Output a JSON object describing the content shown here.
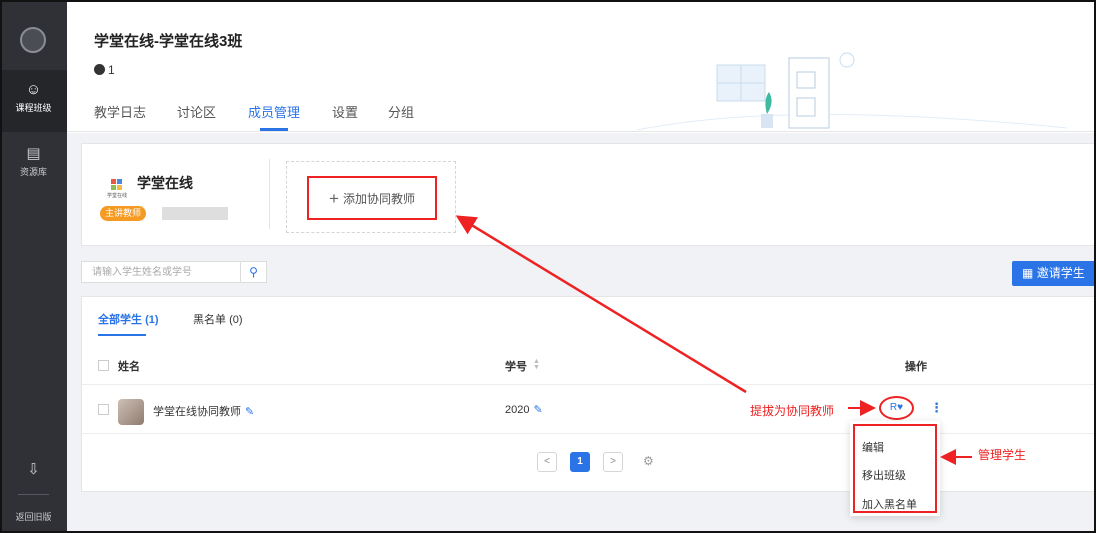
{
  "sidebar": {
    "items": [
      {
        "label": "课程班级",
        "icon": "class-icon",
        "active": true
      },
      {
        "label": "资源库",
        "icon": "library-icon",
        "active": false
      }
    ],
    "bottom_icon": "download-icon",
    "back_label": "返回旧版"
  },
  "header": {
    "title": "学堂在线-学堂在线3班",
    "member_count": "1",
    "tabs": [
      "教学日志",
      "讨论区",
      "成员管理",
      "设置",
      "分组"
    ],
    "active_tab": "成员管理"
  },
  "teacher_card": {
    "school_name": "学堂在线",
    "logo_text": "学堂在线",
    "role_badge": "主讲教师",
    "add_co_teacher_label": "添加协同教师"
  },
  "search": {
    "placeholder": "请输入学生姓名或学号"
  },
  "invite_label": "邀请学生",
  "student_tabs": {
    "all_label": "全部学生",
    "all_count": "(1)",
    "blacklist_label": "黑名单",
    "blacklist_count": "(0)"
  },
  "table": {
    "headers": {
      "name": "姓名",
      "student_id": "学号",
      "actions": "操作"
    },
    "rows": [
      {
        "name": "学堂在线协同教师",
        "student_id": "2020"
      }
    ]
  },
  "pagination": {
    "prev": "<",
    "current": "1",
    "next": ">"
  },
  "dropdown_menu": [
    "编辑",
    "移出班级",
    "加入黑名单"
  ],
  "annotations": {
    "promote": "提拔为协同教师",
    "manage": "管理学生"
  },
  "colors": {
    "accent": "#2a74e8",
    "annotation_red": "#ee2222",
    "sidebar_bg": "#2f3136",
    "badge_orange": "#f59a23"
  }
}
